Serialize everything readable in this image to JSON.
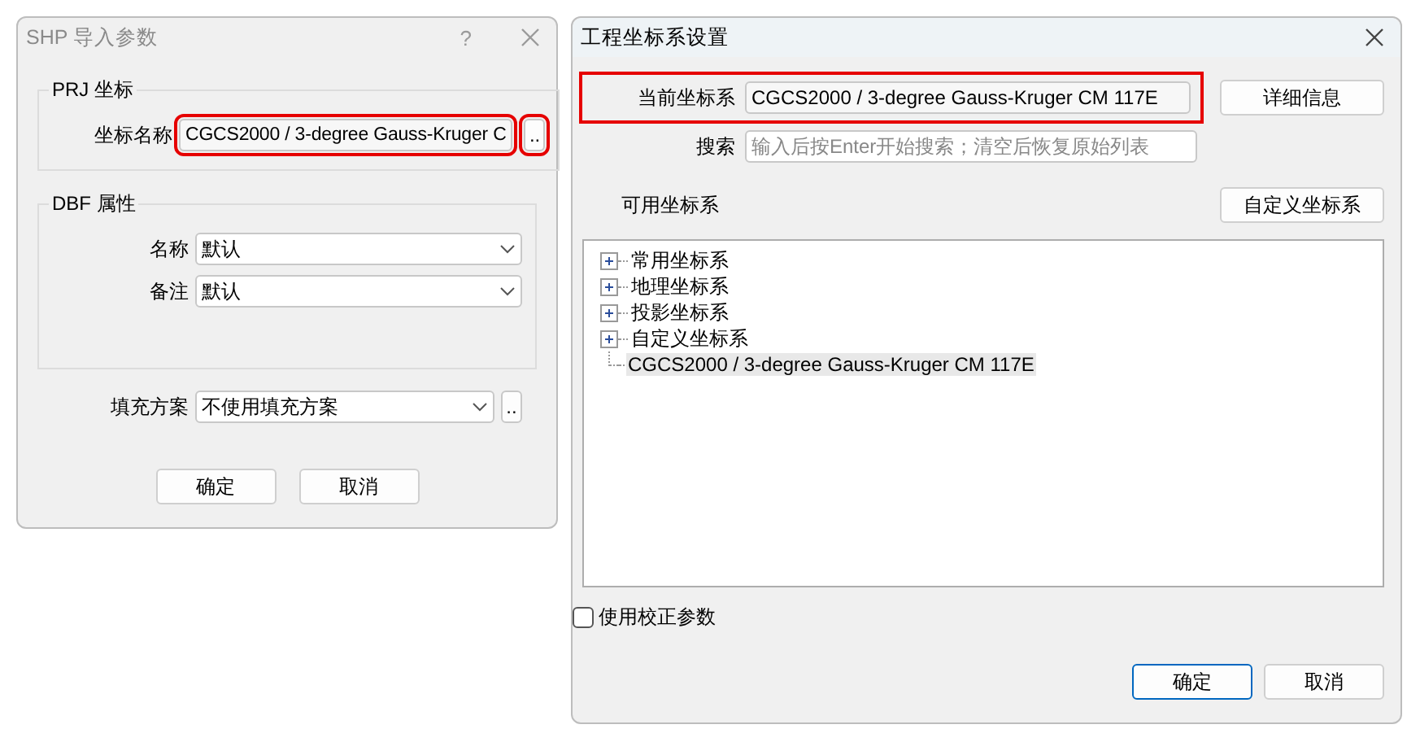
{
  "shp_dialog": {
    "title": "SHP 导入参数",
    "help": "?",
    "active": false,
    "prj_group": {
      "title": "PRJ 坐标",
      "label": "坐标名称",
      "value": "CGCS2000 / 3-degree Gauss-Kruger C",
      "highlighted": true,
      "browse": ".."
    },
    "dbf_group": {
      "title": "DBF 属性",
      "fields": [
        {
          "label": "名称",
          "value": "默认"
        },
        {
          "label": "备注",
          "value": "默认"
        }
      ]
    },
    "fill": {
      "label": "填充方案",
      "value": "不使用填充方案",
      "browse": ".."
    },
    "buttons": [
      {
        "label": "确定",
        "default": false
      },
      {
        "label": "取消",
        "default": false
      }
    ]
  },
  "crs_dialog": {
    "title": "工程坐标系设置",
    "active": true,
    "current": {
      "label": "当前坐标系",
      "value": "CGCS2000 / 3-degree Gauss-Kruger CM 117E",
      "highlighted": true
    },
    "details_button": "详细信息",
    "search": {
      "label": "搜索",
      "placeholder": "输入后按Enter开始搜索；清空后恢复原始列表"
    },
    "available_label": "可用坐标系",
    "custom_button": "自定义坐标系",
    "tree": [
      {
        "kind": "folder",
        "label": "常用坐标系",
        "expanded": false,
        "selected": false
      },
      {
        "kind": "folder",
        "label": "地理坐标系",
        "expanded": false,
        "selected": false
      },
      {
        "kind": "folder",
        "label": "投影坐标系",
        "expanded": false,
        "selected": false
      },
      {
        "kind": "folder",
        "label": "自定义坐标系",
        "expanded": false,
        "selected": false
      },
      {
        "kind": "leaf",
        "label": "CGCS2000 / 3-degree Gauss-Kruger CM 117E",
        "selected": true
      }
    ],
    "checkbox": {
      "label": "使用校正参数",
      "checked": false
    },
    "buttons": [
      {
        "label": "确定",
        "default": true
      },
      {
        "label": "取消",
        "default": false
      }
    ]
  }
}
